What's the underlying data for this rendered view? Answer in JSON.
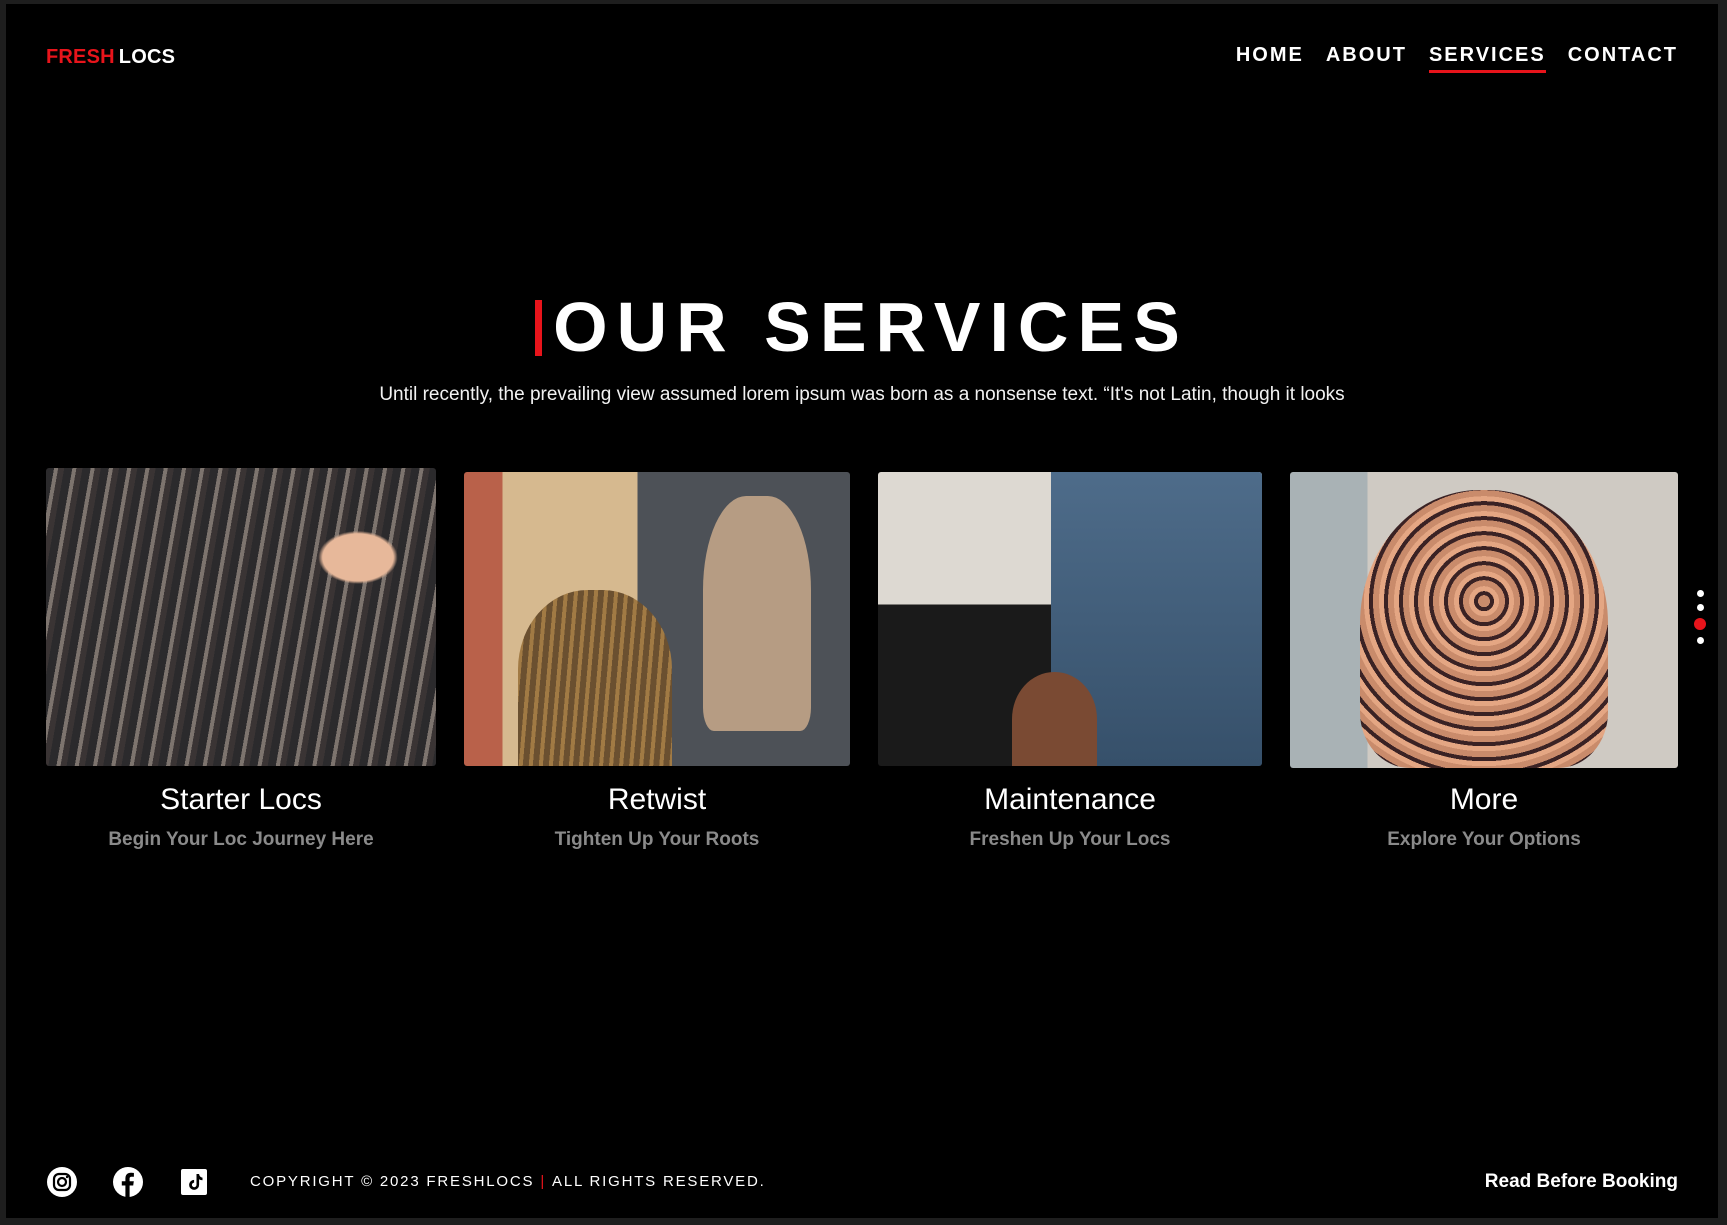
{
  "brand": {
    "part1": "FRESH",
    "part2": "LOCS"
  },
  "nav": [
    {
      "label": "HOME",
      "active": false
    },
    {
      "label": "ABOUT",
      "active": false
    },
    {
      "label": "SERVICES",
      "active": true
    },
    {
      "label": "CONTACT",
      "active": false
    }
  ],
  "hero": {
    "title": "OUR SERVICES",
    "subtitle": "Until recently, the prevailing view assumed lorem ipsum was born as a nonsense text. “It's not Latin, though it looks"
  },
  "services": [
    {
      "title": "Starter Locs",
      "subtitle": "Begin Your Loc Journey Here"
    },
    {
      "title": "Retwist",
      "subtitle": "Tighten Up Your Roots"
    },
    {
      "title": "Maintenance",
      "subtitle": "Freshen Up Your Locs"
    },
    {
      "title": "More",
      "subtitle": "Explore Your Options"
    }
  ],
  "pager": {
    "count": 4,
    "active_index": 2
  },
  "footer": {
    "social": [
      "instagram-icon",
      "facebook-icon",
      "tiktok-icon"
    ],
    "copyright_left": "COPYRIGHT © 2023 FRESHLOCS",
    "copyright_sep": "|",
    "copyright_right": "ALL RIGHTS RESERVED.",
    "read_link": "Read Before Booking"
  },
  "colors": {
    "accent": "#e8141b",
    "background": "#000000",
    "muted": "#8a8a8a"
  }
}
